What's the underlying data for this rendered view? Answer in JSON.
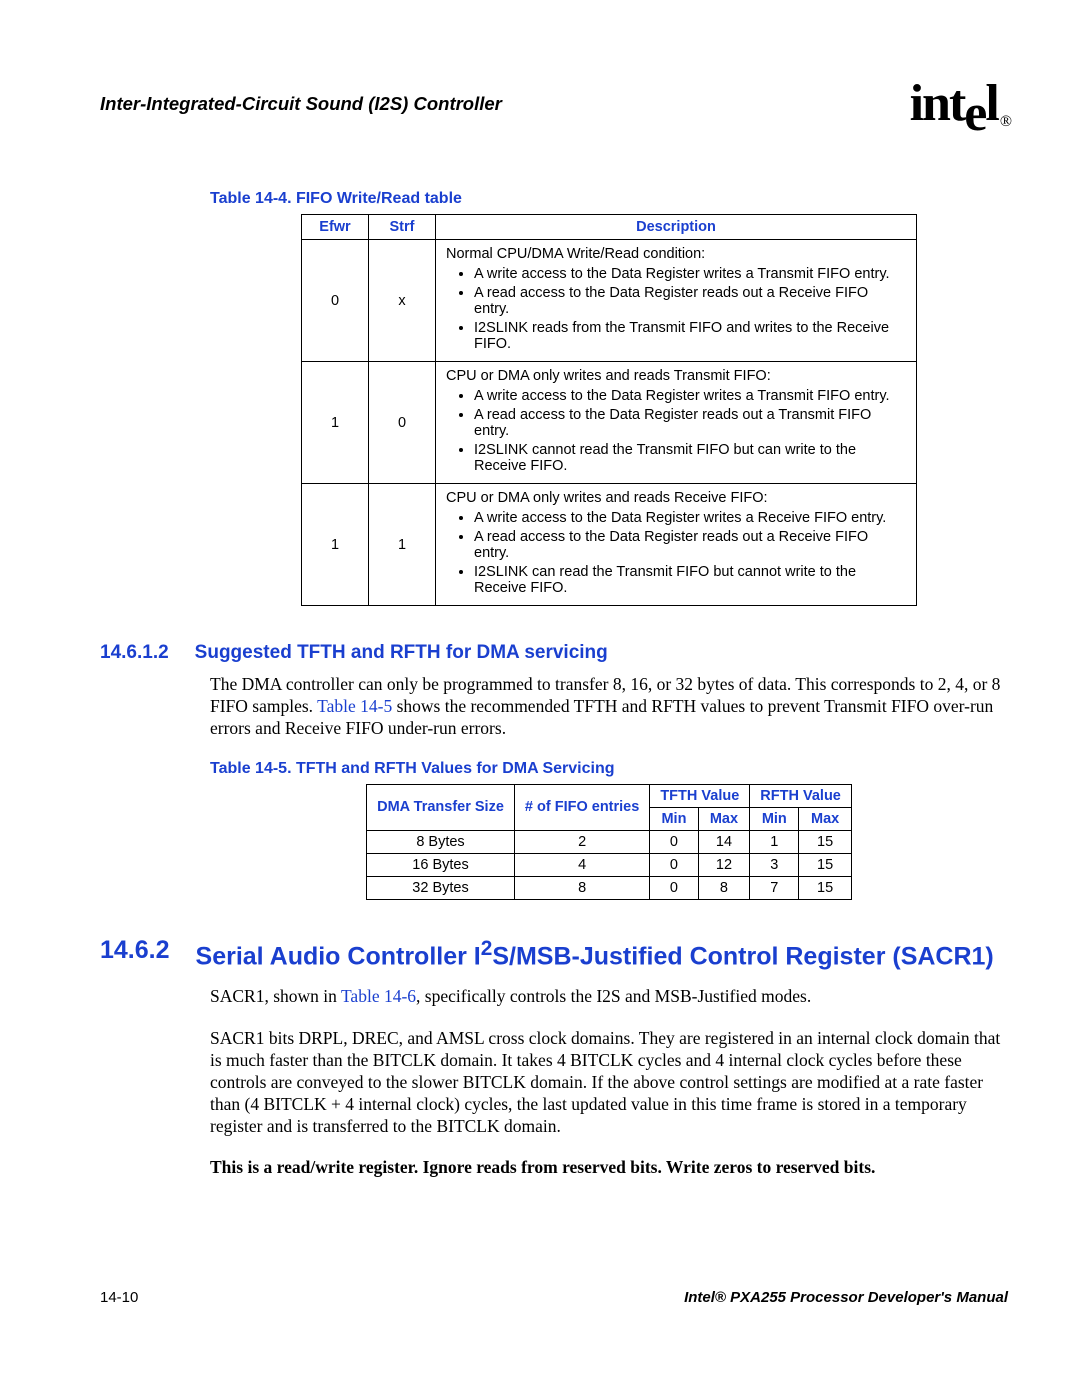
{
  "header": {
    "chapterTitle": "Inter-Integrated-Circuit Sound (I2S) Controller",
    "logo": {
      "text_a": "int",
      "text_drop": "e",
      "text_b": "l",
      "reg": "®"
    }
  },
  "table14_4": {
    "caption": "Table 14-4. FIFO Write/Read table",
    "cols": {
      "c1": "Efwr",
      "c2": "Strf",
      "c3": "Description"
    },
    "rows": [
      {
        "efwr": "0",
        "strf": "x",
        "intro": "Normal CPU/DMA Write/Read condition:",
        "bullets": [
          "A write access to the Data Register writes a Transmit FIFO entry.",
          "A read access to the Data Register reads out a Receive FIFO entry.",
          "I2SLINK reads from the Transmit FIFO and writes to the Receive FIFO."
        ]
      },
      {
        "efwr": "1",
        "strf": "0",
        "intro": "CPU or DMA only writes and reads Transmit FIFO:",
        "bullets": [
          "A write access to the Data Register writes a Transmit FIFO entry.",
          "A read access to the Data Register reads out a Transmit FIFO entry.",
          "I2SLINK cannot read the Transmit FIFO but can write to the Receive FIFO."
        ]
      },
      {
        "efwr": "1",
        "strf": "1",
        "intro": "CPU or DMA only writes and reads Receive FIFO:",
        "bullets": [
          "A write access to the Data Register writes a Receive FIFO entry.",
          "A read access to the Data Register reads out a Receive FIFO entry.",
          "I2SLINK can read the Transmit FIFO but cannot write to the Receive FIFO."
        ]
      }
    ]
  },
  "section14_6_1_2": {
    "num": "14.6.1.2",
    "title": "Suggested TFTH and RFTH for DMA servicing",
    "para_a": "The DMA controller can only be programmed to transfer 8, 16, or 32 bytes of data. This corresponds to 2, 4, or 8 FIFO samples. ",
    "link": "Table 14-5",
    "para_b": " shows the recommended TFTH and RFTH values to prevent Transmit FIFO over-run errors and Receive FIFO under-run errors."
  },
  "table14_5": {
    "caption": "Table 14-5. TFTH and RFTH Values for DMA Servicing",
    "head": {
      "dma": "DMA Transfer Size",
      "entries": "# of FIFO entries",
      "tfth": "TFTH Value",
      "rfth": "RFTH Value",
      "min": "Min",
      "max": "Max"
    },
    "rows": [
      {
        "dma": "8 Bytes",
        "entries": "2",
        "tmin": "0",
        "tmax": "14",
        "rmin": "1",
        "rmax": "15"
      },
      {
        "dma": "16 Bytes",
        "entries": "4",
        "tmin": "0",
        "tmax": "12",
        "rmin": "3",
        "rmax": "15"
      },
      {
        "dma": "32 Bytes",
        "entries": "8",
        "tmin": "0",
        "tmax": "8",
        "rmin": "7",
        "rmax": "15"
      }
    ]
  },
  "section14_6_2": {
    "num": "14.6.2",
    "title_a": "Serial Audio Controller I",
    "title_sup": "2",
    "title_b": "S/MSB-Justified Control Register (SACR1)",
    "p1_a": "SACR1, shown in ",
    "p1_link": "Table 14-6",
    "p1_b": ", specifically controls the I2S and MSB-Justified modes.",
    "p2": "SACR1 bits DRPL, DREC, and AMSL cross clock domains. They are registered in an internal clock domain that is much faster than the BITCLK domain. It takes 4 BITCLK cycles and 4 internal clock cycles before these controls are conveyed to the slower BITCLK domain. If the above control settings are modified at a rate faster than (4 BITCLK + 4 internal clock) cycles, the last updated value in this time frame is stored in a temporary register and is transferred to the BITCLK domain.",
    "p3": "This is a read/write register. Ignore reads from reserved bits. Write zeros to reserved bits."
  },
  "footer": {
    "left": "14-10",
    "right": "Intel® PXA255 Processor Developer's Manual"
  }
}
